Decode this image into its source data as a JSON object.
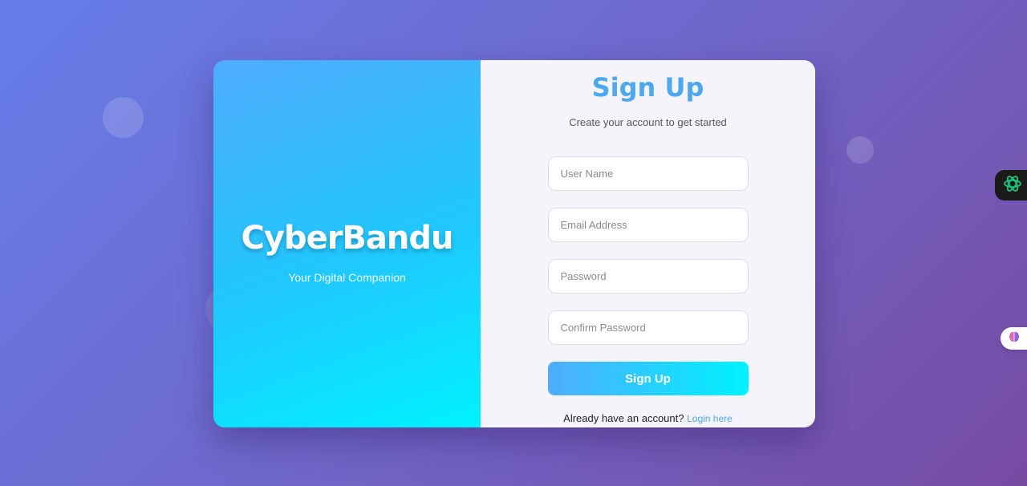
{
  "brand": {
    "title": "CyberBandu",
    "tagline": "Your Digital Companion"
  },
  "form": {
    "title": "Sign Up",
    "subtitle": "Create your account to get started",
    "fields": {
      "username": {
        "placeholder": "User Name",
        "value": ""
      },
      "email": {
        "placeholder": "Email Address",
        "value": ""
      },
      "password": {
        "placeholder": "Password",
        "value": ""
      },
      "confirm_password": {
        "placeholder": "Confirm Password",
        "value": ""
      }
    },
    "submit_label": "Sign Up",
    "login_prompt": "Already have an account?",
    "login_link": "Login here"
  },
  "extensions": {
    "ai_assistant_icon": "openai-knot-icon",
    "brain_icon": "brain-icon"
  },
  "colors": {
    "background_start": "#667eea",
    "background_end": "#764ba2",
    "accent_start": "#4facfe",
    "accent_end": "#00f2fe",
    "title": "#4da8ef"
  }
}
